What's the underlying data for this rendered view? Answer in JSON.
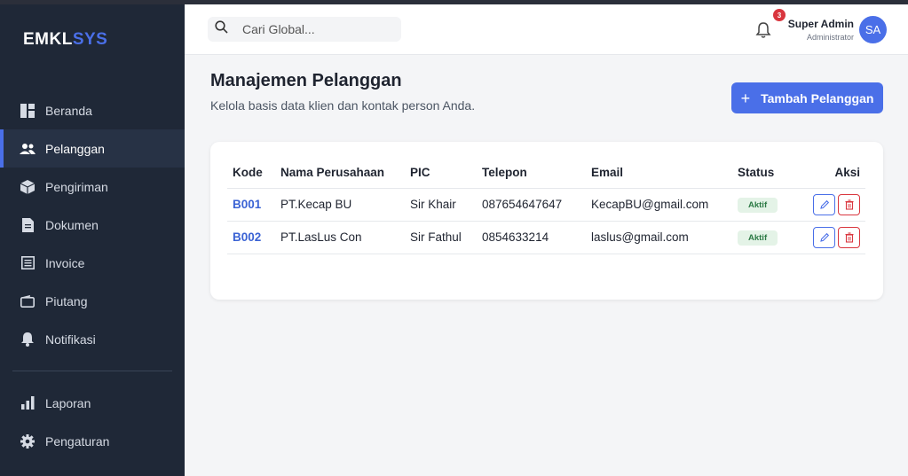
{
  "brand": {
    "part1": "EMKL",
    "part2": "SYS"
  },
  "sidebar": {
    "items": [
      {
        "label": "Beranda",
        "icon": "dashboard-icon",
        "active": false
      },
      {
        "label": "Pelanggan",
        "icon": "users-icon",
        "active": true
      },
      {
        "label": "Pengiriman",
        "icon": "box-icon",
        "active": false
      },
      {
        "label": "Dokumen",
        "icon": "document-icon",
        "active": false
      },
      {
        "label": "Invoice",
        "icon": "invoice-icon",
        "active": false
      },
      {
        "label": "Piutang",
        "icon": "wallet-icon",
        "active": false
      },
      {
        "label": "Notifikasi",
        "icon": "bell-icon",
        "active": false
      }
    ],
    "bottom_items": [
      {
        "label": "Laporan",
        "icon": "chart-icon"
      },
      {
        "label": "Pengaturan",
        "icon": "gear-icon"
      }
    ]
  },
  "header": {
    "search_placeholder": "Cari Global...",
    "notification_count": "3",
    "user_name": "Super Admin",
    "user_role": "Administrator",
    "avatar_initials": "SA"
  },
  "page": {
    "title": "Manajemen Pelanggan",
    "subtitle": "Kelola basis data klien dan kontak person Anda.",
    "add_button": "Tambah Pelanggan"
  },
  "table": {
    "headers": [
      "Kode",
      "Nama Perusahaan",
      "PIC",
      "Telepon",
      "Email",
      "Status",
      "Aksi"
    ],
    "rows": [
      {
        "code": "B001",
        "company": "PT.Kecap BU",
        "pic": "Sir Khair",
        "phone": "087654647647",
        "email": "KecapBU@gmail.com",
        "status": "Aktif"
      },
      {
        "code": "B002",
        "company": "PT.LasLus Con",
        "pic": "Sir Fathul",
        "phone": "0854633214",
        "email": "laslus@gmail.com",
        "status": "Aktif"
      }
    ]
  },
  "colors": {
    "accent": "#4a6fe8",
    "sidebar_bg": "#1f2837",
    "danger": "#d9363e",
    "success_bg": "#e4f3e7",
    "success_text": "#2c7a45"
  }
}
